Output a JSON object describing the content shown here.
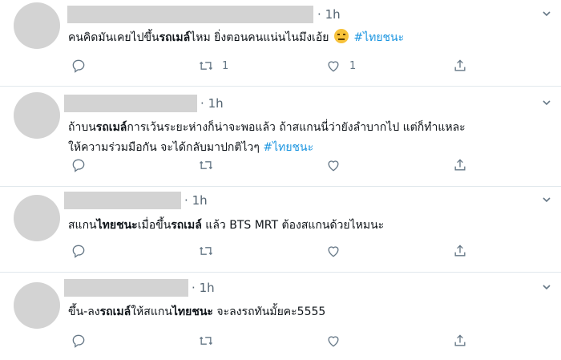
{
  "tweets": [
    {
      "time": "1h",
      "separator": "·",
      "segments": [
        {
          "t": "คนคิดมันเคยไปขึ้น",
          "s": "normal"
        },
        {
          "t": "รถเมล์",
          "s": "bold"
        },
        {
          "t": "ไหม ยิ่งตอนคนแน่นไนมึงเอ้ย ",
          "s": "normal"
        },
        {
          "t": "emoji",
          "s": "emoji"
        },
        {
          "t": " #ไทยชนะ",
          "s": "tag"
        }
      ],
      "retweets": "1",
      "likes": "1",
      "emoji_name": "unamused-face-emoji"
    },
    {
      "time": "1h",
      "separator": "·",
      "line1": [
        {
          "t": "ถ้าบน",
          "s": "normal"
        },
        {
          "t": "รถเมล์",
          "s": "bold"
        },
        {
          "t": "การเว้นระยะห่างก็น่าจะพอแล้ว ถ้าสแกนนี่ว่ายังลำบากไป แต่ก็ทำแหละ",
          "s": "normal"
        }
      ],
      "line2": [
        {
          "t": "ให้ความร่วมมือกัน จะได้กลับมาปกติไวๆ ",
          "s": "normal"
        },
        {
          "t": "#ไทยชนะ",
          "s": "tag"
        }
      ],
      "retweets": "",
      "likes": ""
    },
    {
      "time": "1h",
      "separator": "·",
      "segments": [
        {
          "t": "สแกน",
          "s": "normal"
        },
        {
          "t": "ไทยชนะ",
          "s": "bold"
        },
        {
          "t": "เมื่อขึ้น",
          "s": "normal"
        },
        {
          "t": "รถเมล์",
          "s": "bold"
        },
        {
          "t": " แล้ว BTS MRT ต้องสแกนด้วยไหมนะ",
          "s": "normal"
        }
      ],
      "retweets": "",
      "likes": ""
    },
    {
      "time": "1h",
      "separator": "·",
      "segments": [
        {
          "t": "ขึ้น-ลง",
          "s": "normal"
        },
        {
          "t": "รถเมล์",
          "s": "bold"
        },
        {
          "t": "ให้สแกน",
          "s": "normal"
        },
        {
          "t": "ไทยชนะ",
          "s": "bold"
        },
        {
          "t": " จะลงรถทันมั้ยคะ5555",
          "s": "normal"
        }
      ],
      "retweets": "",
      "likes": ""
    }
  ],
  "icons": {
    "reply": "reply-icon",
    "retweet": "retweet-icon",
    "like": "heart-icon",
    "share": "share-icon",
    "menu": "chevron-down-icon"
  },
  "colors": {
    "hashtag": "#1b95e0",
    "meta_text": "#536471",
    "icon": "#657786",
    "placeholder": "#d3d3d3"
  }
}
